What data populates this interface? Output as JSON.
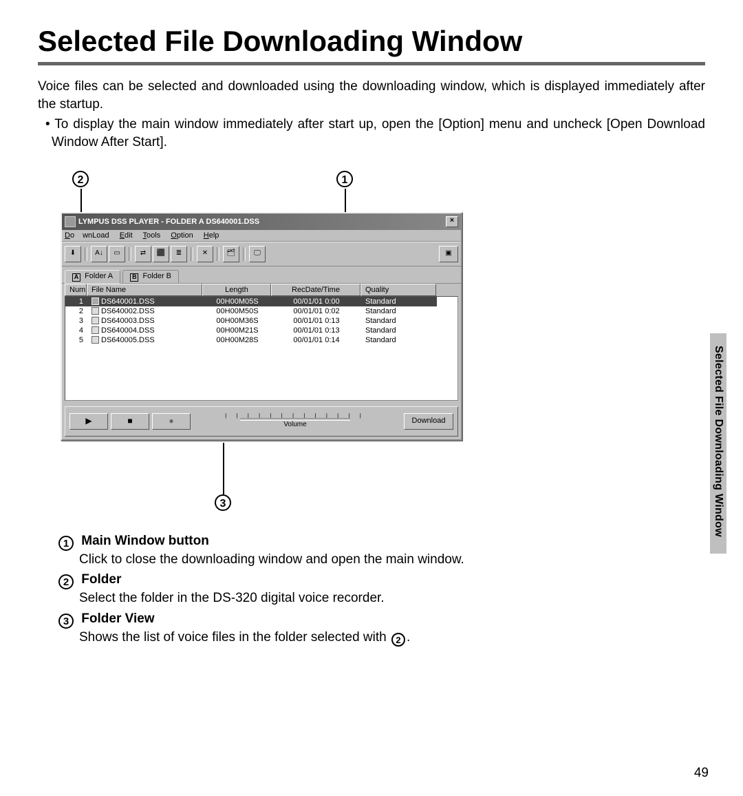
{
  "page": {
    "title": "Selected File Downloading Window",
    "intro1": "Voice files can be selected and downloaded using the downloading window, which is displayed immediately after the startup.",
    "intro2": "To display the main window immediately after start up, open the [Option] menu and uncheck [Open Download Window After Start].",
    "side_label": "Selected File Downloading Window",
    "number": "49"
  },
  "callouts": {
    "c1": "1",
    "c2": "2",
    "c3": "3"
  },
  "window": {
    "title": "LYMPUS DSS PLAYER  -  FOLDER A  DS640001.DSS",
    "close": "×",
    "menu": {
      "download": "DownLoad",
      "edit": "Edit",
      "tools": "Tools",
      "option": "Option",
      "help": "Help"
    },
    "tabs": {
      "a_icon": "A",
      "a_label": "Folder A",
      "b_icon": "B",
      "b_label": "Folder B"
    },
    "cols": {
      "num": "Num",
      "name": "File Name",
      "len": "Length",
      "date": "RecDate/Time",
      "qual": "Quality"
    },
    "rows": [
      {
        "num": "1",
        "name": "DS640001.DSS",
        "len": "00H00M05S",
        "date": "00/01/01 0:00",
        "qual": "Standard",
        "selected": true
      },
      {
        "num": "2",
        "name": "DS640002.DSS",
        "len": "00H00M50S",
        "date": "00/01/01 0:02",
        "qual": "Standard"
      },
      {
        "num": "3",
        "name": "DS640003.DSS",
        "len": "00H00M36S",
        "date": "00/01/01 0:13",
        "qual": "Standard"
      },
      {
        "num": "4",
        "name": "DS640004.DSS",
        "len": "00H00M21S",
        "date": "00/01/01 0:13",
        "qual": "Standard"
      },
      {
        "num": "5",
        "name": "DS640005.DSS",
        "len": "00H00M28S",
        "date": "00/01/01 0:14",
        "qual": "Standard"
      }
    ],
    "playback": {
      "play": "▶",
      "stop": "■",
      "rec": "●",
      "vol_label": "Volume",
      "download": "Download"
    }
  },
  "annotations": {
    "a1_num": "1",
    "a1_head": "Main Window button",
    "a1_body": "Click to close the downloading window and open the main window.",
    "a2_num": "2",
    "a2_head": "Folder",
    "a2_body": "Select the folder in the DS-320 digital voice recorder.",
    "a3_num": "3",
    "a3_head": "Folder View",
    "a3_body_pre": "Shows the list of voice files in the folder selected with ",
    "a3_body_ref": "2",
    "a3_body_post": "."
  }
}
